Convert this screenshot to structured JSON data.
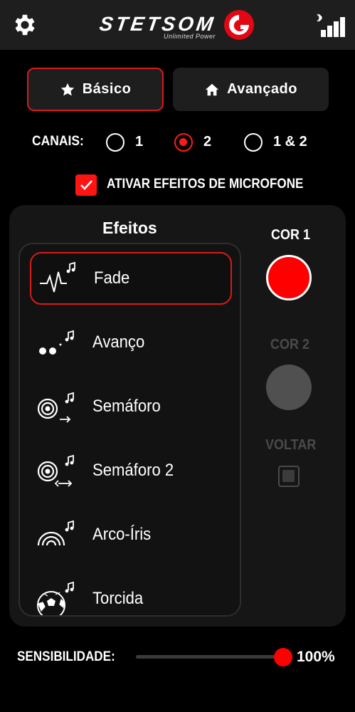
{
  "header": {
    "brand": "STETSOM",
    "tagline": "Unlimited Power",
    "brand_color": "#e30613"
  },
  "modes": [
    {
      "label": "Básico",
      "icon": "star-icon",
      "selected": true
    },
    {
      "label": "Avançado",
      "icon": "home-icon",
      "selected": false
    }
  ],
  "channels": {
    "label": "CANAIS:",
    "options": [
      {
        "label": "1",
        "selected": false
      },
      {
        "label": "2",
        "selected": true
      },
      {
        "label": "1 & 2",
        "selected": false
      }
    ]
  },
  "microphone": {
    "label": "ATIVAR EFEITOS DE MICROFONE",
    "checked": true
  },
  "effects": {
    "title": "Efeitos",
    "items": [
      {
        "label": "Fade",
        "icon": "fade-wave-icon",
        "selected": true
      },
      {
        "label": "Avanço",
        "icon": "dots-music-icon",
        "selected": false
      },
      {
        "label": "Semáforo",
        "icon": "target-arrow-icon",
        "selected": false
      },
      {
        "label": "Semáforo 2",
        "icon": "target-double-arrow-icon",
        "selected": false
      },
      {
        "label": "Arco-Íris",
        "icon": "rainbow-icon",
        "selected": false
      },
      {
        "label": "Torcida",
        "icon": "soccer-ball-icon",
        "selected": false
      }
    ]
  },
  "colors": {
    "cor1_label": "COR 1",
    "cor1_value": "#ff0000",
    "cor2_label": "COR 2",
    "cor2_value": "#505050",
    "voltar_label": "VOLTAR",
    "voltar_checked": false
  },
  "sensitivity": {
    "label": "SENSIBILIDADE:",
    "value_text": "100%",
    "value": 100,
    "accent": "#ff0000"
  }
}
